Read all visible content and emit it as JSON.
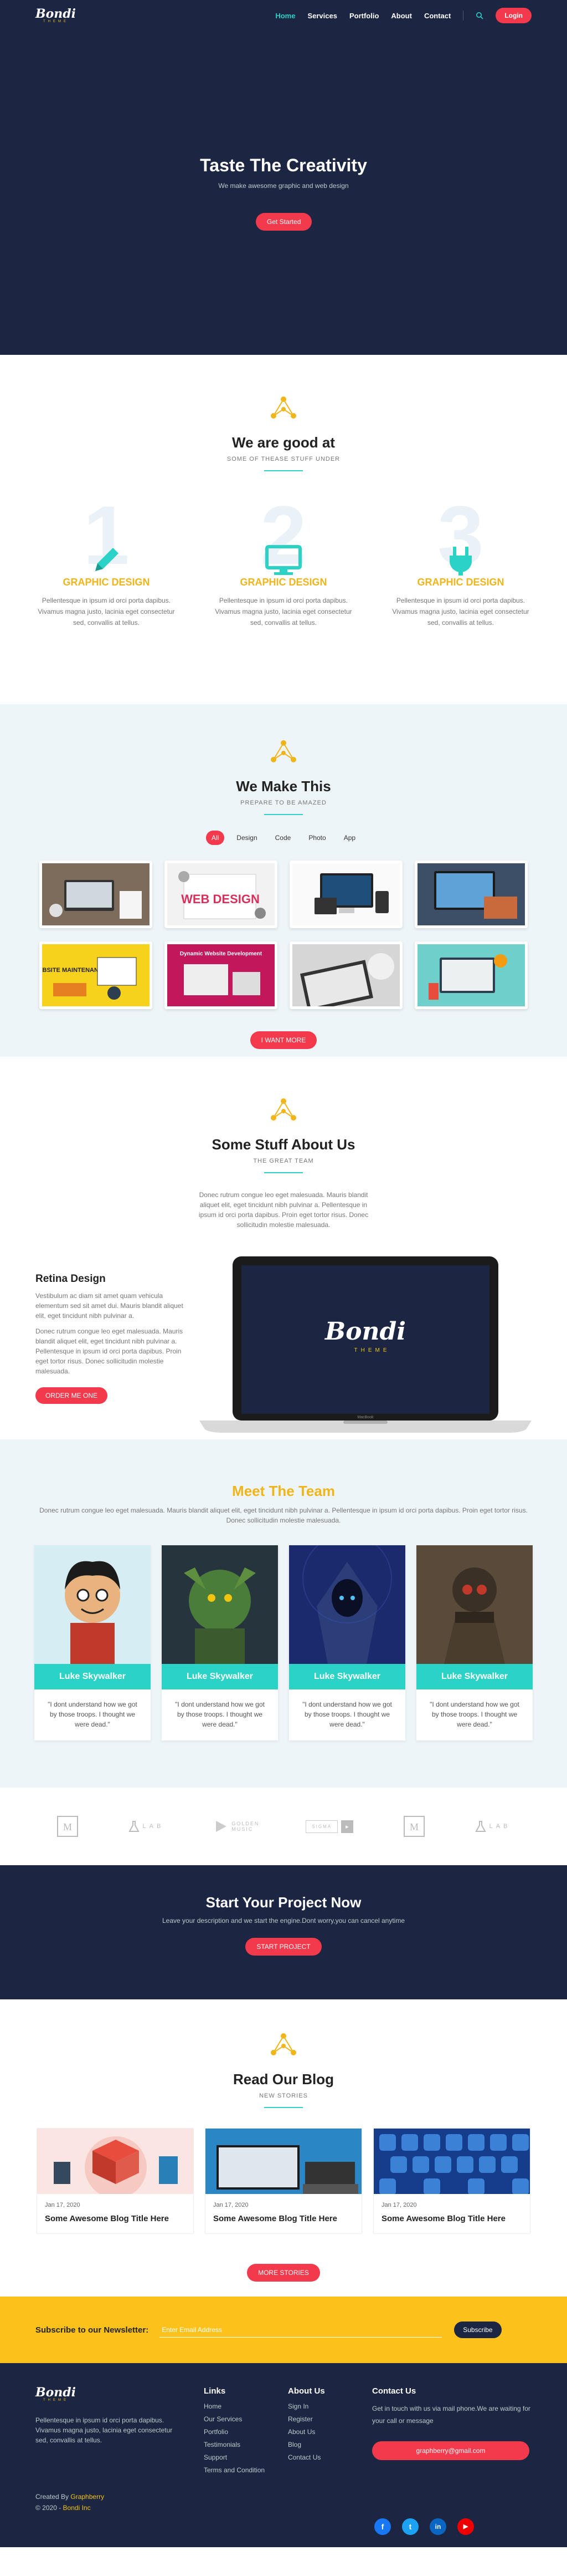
{
  "nav": {
    "logo": "Bondi",
    "logo_sub": "THEME",
    "items": [
      "Home",
      "Services",
      "Portfolio",
      "About",
      "Contact"
    ],
    "login": "Login"
  },
  "hero": {
    "title": "Taste The Creativity",
    "subtitle": "We make awesome graphic and web design",
    "button": "Get Started"
  },
  "good": {
    "title": "We are good at",
    "subtitle": "SOME OF THEASE STUFF UNDER",
    "cols": [
      {
        "num": "1",
        "icon": "pencil-icon",
        "title": "GRAPHIC DESIGN",
        "text": "Pellentesque in ipsum id orci porta dapibus. Vivamus magna justo, lacinia eget consectetur sed, convallis at tellus."
      },
      {
        "num": "2",
        "icon": "monitor-icon",
        "title": "GRAPHIC DESIGN",
        "text": "Pellentesque in ipsum id orci porta dapibus. Vivamus magna justo, lacinia eget consectetur sed, convallis at tellus."
      },
      {
        "num": "3",
        "icon": "plug-icon",
        "title": "GRAPHIC DESIGN",
        "text": "Pellentesque in ipsum id orci porta dapibus. Vivamus magna justo, lacinia eget consectetur sed, convallis at tellus."
      }
    ]
  },
  "make": {
    "title": "We Make This",
    "subtitle": "PREPARE TO BE AMAZED",
    "filters": [
      "All",
      "Design",
      "Code",
      "Photo",
      "App"
    ],
    "tile_web": "WEB DESIGN",
    "tile_maint": "WEBSITE MAINTENANCE",
    "tile_dyn": "Dynamic Website Development",
    "button": "I WANT MORE"
  },
  "about": {
    "title": "Some Stuff About Us",
    "subtitle": "THE GREAT TEAM",
    "text": "Donec rutrum congue leo eget malesuada. Mauris blandit aliquet elit, eget tincidunt nibh pulvinar a. Pellentesque in ipsum id orci porta dapibus. Proin eget tortor risus. Donec sollicitudin molestie malesuada.",
    "retina_title": "Retina Design",
    "retina_p1": "Vestibulum ac diam sit amet quam vehicula elementum sed sit amet dui. Mauris blandit aliquet elit, eget tincidunt nibh pulvinar a.",
    "retina_p2": "Donec rutrum congue leo eget malesuada. Mauris blandit aliquet elit, eget tincidunt nibh pulvinar a. Pellentesque in ipsum id orci porta dapibus. Proin eget tortor risus. Donec sollicitudin molestie malesuada.",
    "retina_btn": "ORDER ME ONE",
    "laptop_logo": "Bondi",
    "laptop_sub": "THEME",
    "laptop_brand": "MacBook"
  },
  "team": {
    "title": "Meet The Team",
    "text": "Donec rutrum congue leo eget malesuada. Mauris blandit aliquet elit, eget tincidunt nibh pulvinar a. Pellentesque in ipsum id orci porta dapibus. Proin eget tortor risus. Donec sollicitudin molestie malesuada.",
    "members": [
      {
        "name": "Luke Skywalker",
        "quote": "\"I dont understand how we got by those troops. I thought we were dead.\""
      },
      {
        "name": "Luke Skywalker",
        "quote": "\"I dont understand how we got by those troops. I thought we were dead.\""
      },
      {
        "name": "Luke Skywalker",
        "quote": "\"I dont understand how we got by those troops. I thought we were dead.\""
      },
      {
        "name": "Luke Skywalker",
        "quote": "\"I dont understand how we got by those troops. I thought we were dead.\""
      }
    ]
  },
  "logos": [
    "M",
    "LAB",
    "GOLDEN MUSIC",
    "SIGMA",
    "M",
    "LAB"
  ],
  "project": {
    "title": "Start Your Project Now",
    "text": "Leave your description and we start the engine.Dont worry,you can cancel anytime",
    "button": "START PROJECT"
  },
  "blog": {
    "title": "Read Our Blog",
    "subtitle": "NEW STORIES",
    "posts": [
      {
        "date": "Jan 17, 2020",
        "title": "Some Awesome Blog Title Here"
      },
      {
        "date": "Jan 17, 2020",
        "title": "Some Awesome Blog Title Here"
      },
      {
        "date": "Jan 17, 2020",
        "title": "Some Awesome Blog Title Here"
      }
    ],
    "button": "MORE STORIES"
  },
  "newsletter": {
    "label": "Subscribe to our Newsletter:",
    "placeholder": "Enter Email Address",
    "button": "Subscribe"
  },
  "footer": {
    "logo": "Bondi",
    "logo_sub": "THEME",
    "text": "Pellentesque in ipsum id orci porta dapibus. Vivamus magna justo, lacinia eget consectetur sed, convallis at tellus.",
    "created": "Created By ",
    "creator": "Graphberry",
    "copy": "© 2020 - ",
    "copy_brand": "Bondi Inc",
    "links_title": "Links",
    "links": [
      "Home",
      "Our Services",
      "Portfolio",
      "Testimonials",
      "Support",
      "Terms and Condition"
    ],
    "about_title": "About Us",
    "about_links": [
      "Sign In",
      "Register",
      "About Us",
      "Blog",
      "Contact Us"
    ],
    "contact_title": "Contact Us",
    "contact_text": "Get in touch with us via mail phone.We are waiting for your call or message",
    "email": "graphberry@gmail.com",
    "social": [
      "f",
      "t",
      "in",
      "▶"
    ],
    "colors": {
      "accent": "#f33a4d",
      "teal": "#2bd2c6",
      "gold": "#f1b51c",
      "navy": "#1c2541"
    }
  }
}
